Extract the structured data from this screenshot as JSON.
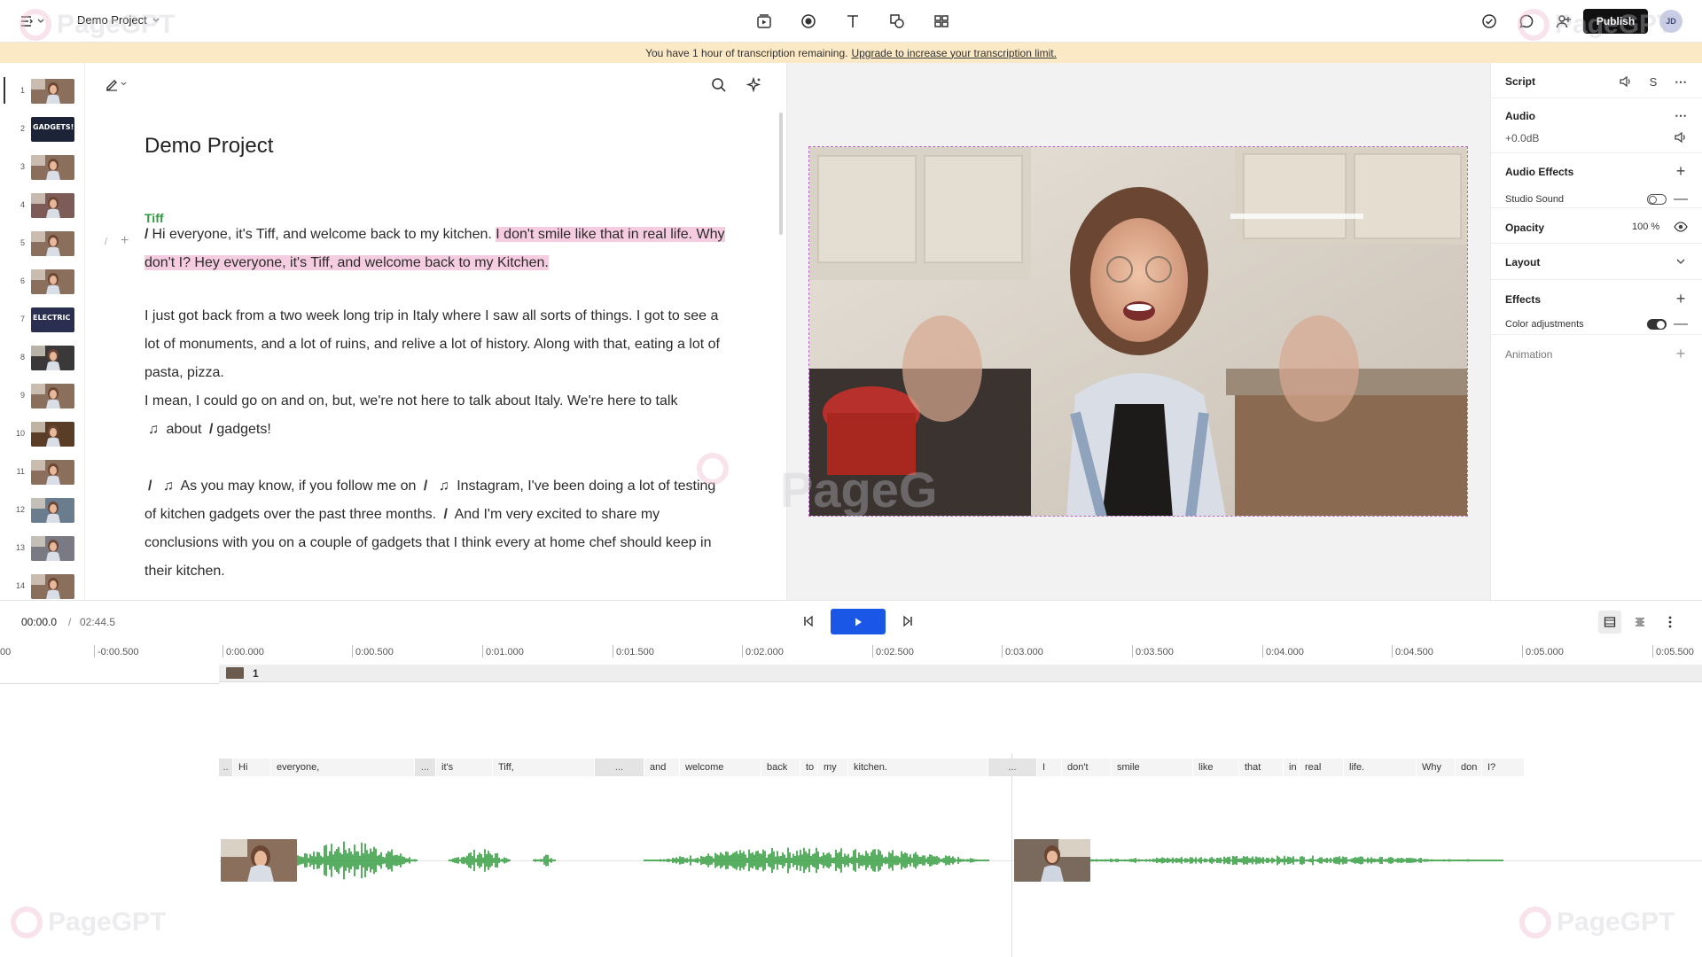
{
  "app": {
    "project_title": "Demo Project",
    "publish_label": "Publish",
    "avatar_initials": "JD",
    "accent_color": "#1a57e6",
    "speaker_color": "#2f9a3f",
    "highlight_color": "#f6cde0",
    "banner_color": "#fbe8c4"
  },
  "toolbar": {
    "center_icons": [
      "record-scene-icon",
      "record-icon",
      "text-icon",
      "shapes-icon",
      "grid-icon"
    ],
    "right_icons": [
      "check-circle-icon",
      "comment-icon",
      "add-user-icon"
    ]
  },
  "banner": {
    "text": "You have 1 hour of transcription remaining.",
    "link": "Upgrade to increase your transcription limit."
  },
  "scenes": {
    "numbers": [
      "1",
      "2",
      "3",
      "4",
      "5",
      "6",
      "7",
      "8",
      "9",
      "10",
      "11",
      "12",
      "13",
      "14"
    ],
    "thumb_texts": {
      "2": "GADGETS!",
      "7": "ELECTRIC"
    },
    "active": "1"
  },
  "editor": {
    "doc_title": "Demo Project",
    "speaker": "Tiff",
    "p1_text": "Hi everyone, it's Tiff, and welcome back to my kitchen.",
    "p1_highlight": "I don't smile like that in real life. Why don't I? Hey everyone, it's Tiff, and welcome back to my Kitchen.",
    "p2_a": "I just got back from a two week long trip in Italy where I saw all sorts of things. I got to see a lot of monuments, and a lot of ruins,",
    "p2_b": "and relive a lot of history. Along with that, eating a lot of pasta, pizza.",
    "p3_a": "I mean,",
    "p3_b": "I could go on and on, but,",
    "p3_c": "we're not here to talk about Italy. We're here to talk",
    "p3_d": "about",
    "p3_e": "gadgets!",
    "p4_a": "As you may know, if you follow me on",
    "p4_b": "Instagram, I've been doing a lot of testing of kitchen gadgets over the past three months.",
    "p4_c": "And I'm very excited to share my conclusions with you on a couple of gadgets that I think every at home chef should keep in their kitchen."
  },
  "properties": {
    "script_label": "Script",
    "audio_label": "Audio",
    "audio_value": "+0.0dB",
    "audio_effects_label": "Audio Effects",
    "studio_sound_label": "Studio Sound",
    "studio_sound_on": false,
    "opacity_label": "Opacity",
    "opacity_value": "100 %",
    "layout_label": "Layout",
    "effects_label": "Effects",
    "color_adjustments_label": "Color adjustments",
    "color_adjustments_on": true,
    "animation_label": "Animation"
  },
  "transport": {
    "current_time": "00:00.0",
    "separator": "/",
    "total_time": "02:44.5"
  },
  "timeline": {
    "ruler": [
      "00",
      "-0:00.500",
      "0:00.000",
      "0:00.500",
      "0:01.000",
      "0:01.500",
      "0:02.000",
      "0:02.500",
      "0:03.000",
      "0:03.500",
      "0:04.000",
      "0:04.500",
      "0:05.000",
      "0:05.500"
    ],
    "scene_number": "1",
    "words": [
      "..",
      "Hi",
      "everyone,",
      "...",
      "it's",
      "Tiff,",
      "...",
      "and",
      "welcome",
      "back",
      "to",
      "my",
      "kitchen.",
      "...",
      "I",
      "don't",
      "smile",
      "like",
      "that",
      "in",
      "real",
      "life.",
      "Why",
      "don",
      "I?"
    ],
    "waveform_color": "#2e9a3a"
  }
}
